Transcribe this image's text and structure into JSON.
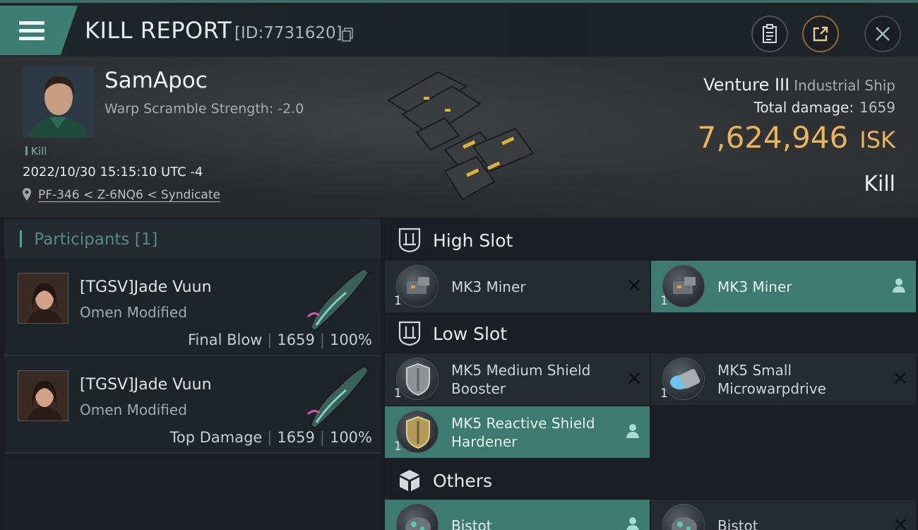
{
  "header": {
    "title": "KILL REPORT",
    "report_id": "[ID:7731620]",
    "icons": [
      "menu-icon",
      "copy-icon",
      "clipboard-icon",
      "share-icon",
      "close-icon"
    ]
  },
  "victim": {
    "name": "SamApoc",
    "warp_scramble": "Warp Scramble Strength: -2.0",
    "tag": "Kill",
    "datetime": "2022/10/30 15:15:10 UTC -4",
    "location": "PF-346 < Z-6NQ6 < Syndicate",
    "ship_name": "Venture III",
    "ship_class": "Industrial Ship",
    "total_damage_label": "Total damage:",
    "total_damage": "1659",
    "isk_value": "7,624,946",
    "isk_unit": "ISK",
    "result": "Kill"
  },
  "participants": {
    "title": "Participants",
    "count": "[1]",
    "rows": [
      {
        "name": "[TGSV]Jade Vuun",
        "ship": "Omen Modified",
        "role": "Final Blow",
        "damage": "1659",
        "percent": "100%"
      },
      {
        "name": "[TGSV]Jade Vuun",
        "ship": "Omen Modified",
        "role": "Top Damage",
        "damage": "1659",
        "percent": "100%"
      }
    ]
  },
  "slots": {
    "high": {
      "title": "High Slot",
      "items": [
        {
          "name": "MK3 Miner",
          "qty": "1",
          "state": "destroyed"
        },
        {
          "name": "MK3 Miner",
          "qty": "1",
          "state": "dropped"
        }
      ]
    },
    "low": {
      "title": "Low Slot",
      "items": [
        {
          "name": "MK5 Medium Shield Booster",
          "line1": "MK5 Medium Shield",
          "line2": "Booster",
          "qty": "1",
          "state": "destroyed"
        },
        {
          "name": "MK5 Small Microwarpdrive",
          "line1": "MK5 Small",
          "line2": "Microwarpdrive",
          "qty": "1",
          "state": "destroyed"
        },
        {
          "name": "MK5 Reactive Shield Hardener",
          "line1": "MK5 Reactive Shield",
          "line2": "Hardener",
          "qty": "1",
          "state": "dropped"
        }
      ]
    },
    "others": {
      "title": "Others",
      "items": [
        {
          "name": "Bistot",
          "qty": "",
          "state": "dropped"
        },
        {
          "name": "Bistot",
          "qty": "",
          "state": "destroyed"
        }
      ]
    }
  },
  "colors": {
    "accent": "#3d7a70",
    "isk_gold": "#e6b45e",
    "panel": "#262b31"
  }
}
